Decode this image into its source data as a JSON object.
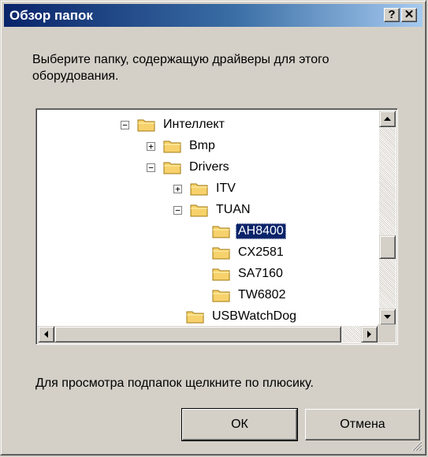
{
  "dialog": {
    "title": "Обзор папок",
    "help_button": "?",
    "close_button": "✕",
    "prompt": "Выберите папку, содержащую драйверы для этого оборудования.",
    "hint": "Для просмотра подпапок щелкните по плюсику.",
    "ok_label": "ОК",
    "cancel_label": "Отмена"
  },
  "tree": {
    "nodes": [
      {
        "label": "Интеллект",
        "expander": "minus"
      },
      {
        "label": "Bmp",
        "expander": "plus"
      },
      {
        "label": "Drivers",
        "expander": "minus"
      },
      {
        "label": "ITV",
        "expander": "plus"
      },
      {
        "label": "TUAN",
        "expander": "minus"
      },
      {
        "label": "AH8400",
        "expander": "none",
        "selected": true
      },
      {
        "label": "CX2581",
        "expander": "none"
      },
      {
        "label": "SA7160",
        "expander": "none"
      },
      {
        "label": "TW6802",
        "expander": "none"
      },
      {
        "label": "USBWatchDog",
        "expander": "none"
      }
    ]
  },
  "colors": {
    "title_gradient_start": "#0a246a",
    "selection": "#0a246a",
    "folder": "#f7d26c"
  }
}
